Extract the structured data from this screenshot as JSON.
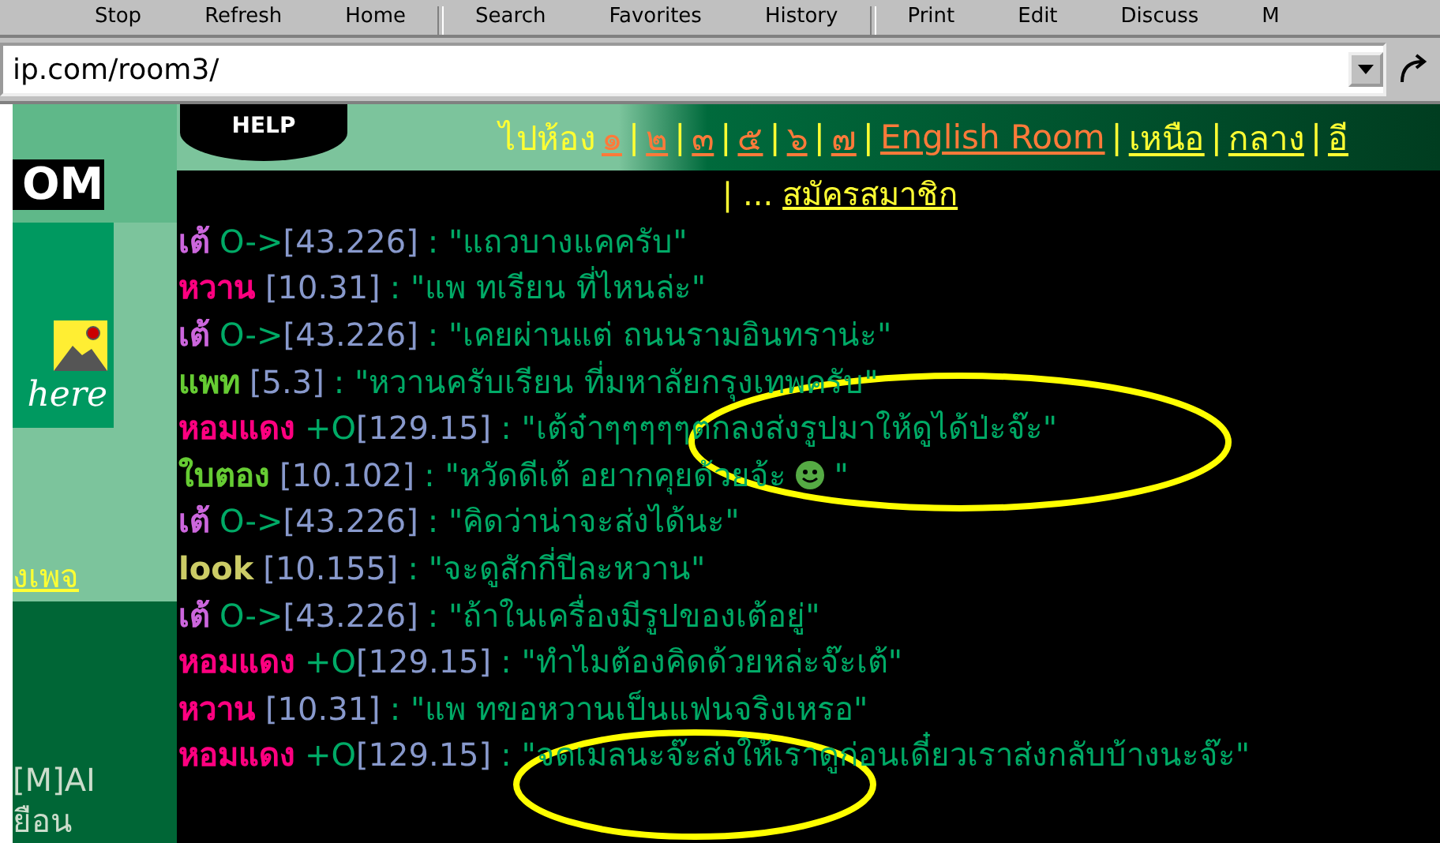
{
  "toolbar": {
    "groups": [
      [
        "Stop",
        "Refresh",
        "Home"
      ],
      [
        "Search",
        "Favorites",
        "History"
      ],
      [
        "Print",
        "Edit",
        "Discuss",
        "M"
      ]
    ]
  },
  "address_bar": {
    "value": "ip.com/room3/"
  },
  "sidebar": {
    "logo": "OM",
    "banner": "here",
    "link": "งเพจ",
    "lines": [
      "[M]AI",
      "ยือน"
    ]
  },
  "header": {
    "help": "HELP",
    "nav_label": "ไปห้อง",
    "separator": "|",
    "links": [
      {
        "label": "๑",
        "kind": "room"
      },
      {
        "label": "๒",
        "kind": "room"
      },
      {
        "label": "๓",
        "kind": "room"
      },
      {
        "label": "๕",
        "kind": "room"
      },
      {
        "label": "๖",
        "kind": "room"
      },
      {
        "label": "๗",
        "kind": "room"
      },
      {
        "label": "English Room",
        "kind": "room"
      },
      {
        "label": "เหนือ",
        "kind": "section"
      },
      {
        "label": "กลาง",
        "kind": "section"
      },
      {
        "label": "อี",
        "kind": "section"
      }
    ],
    "second_line": {
      "prefix": "| ...",
      "link": "สมัครสมาชิก"
    }
  },
  "messages": [
    {
      "name": "เต้",
      "color": "#cc66dd",
      "tag": "O->",
      "ip": "[43.226]",
      "text": ": \"แถวบางแคครับ\""
    },
    {
      "name": "หวาน",
      "color": "#ff0080",
      "ip": "[10.31]",
      "text": ": \"แพ ทเรียน ที่ไหนล่ะ\""
    },
    {
      "name": "เต้",
      "color": "#cc66dd",
      "tag": "O->",
      "ip": "[43.226]",
      "text": ": \"เคยผ่านแต่ ถนนรามอินทราน่ะ\""
    },
    {
      "name": "แพท",
      "color": "#66cc33",
      "ip": "[5.3]",
      "text": ": \"หวานครับเรียน ที่มหาลัยกรุงเทพครับ\""
    },
    {
      "name": "หอมแดง",
      "color": "#ff0080",
      "tag": "+O",
      "ip": "[129.15]",
      "text": ": \"เต้จ๋าๆๆๆๆๆตกลงส่งรูปมาให้ดูได้ป่ะจ๊ะ\""
    },
    {
      "name": "ใบตอง",
      "color": "#66cc33",
      "ip": "[10.102]",
      "text": ": \"หวัดดีเต้ อยากคุยด้วยจ้ะ",
      "smiley": true,
      "text_after": "\""
    },
    {
      "name": "เต้",
      "color": "#cc66dd",
      "tag": "O->",
      "ip": "[43.226]",
      "text": ": \"คิดว่าน่าจะส่งได้นะ\""
    },
    {
      "name": "look",
      "color": "#cccc66",
      "ip": "[10.155]",
      "text": ": \"จะดูสักกี่ปีละหวาน\""
    },
    {
      "name": "เต้",
      "color": "#cc66dd",
      "tag": "O->",
      "ip": "[43.226]",
      "text": ": \"ถ้าในเครื่องมีรูปของเต้อยู่\""
    },
    {
      "name": "หอมแดง",
      "color": "#ff0080",
      "tag": "+O",
      "ip": "[129.15]",
      "text": ": \"ทำไมต้องคิดด้วยหล่ะจ๊ะเต้\""
    },
    {
      "name": "หวาน",
      "color": "#ff0080",
      "ip": "[10.31]",
      "text": ": \"แพ ทขอหวานเป็นแฟนจริงเหรอ\""
    },
    {
      "name": "หอมแดง",
      "color": "#ff0080",
      "tag": "+O",
      "ip": "[129.15]",
      "text": ": \"จดเมลนะจ๊ะส่งให้เราดูก่อนเดี๋ยวเราส่งกลับบ้างนะจ๊ะ\""
    }
  ],
  "annotations": [
    {
      "kind": "ellipse"
    },
    {
      "kind": "ellipse"
    }
  ]
}
